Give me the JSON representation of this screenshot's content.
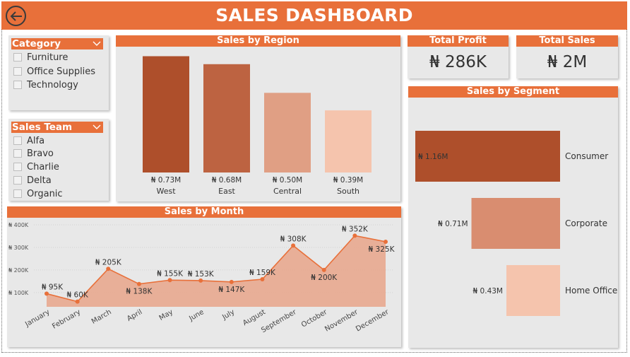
{
  "header": {
    "title": "SALES DASHBOARD"
  },
  "category_slicer": {
    "title": "Category",
    "options": [
      "Furniture",
      "Office Supplies",
      "Technology"
    ]
  },
  "sales_team_slicer": {
    "title": "Sales Team",
    "options": [
      "Alfa",
      "Bravo",
      "Charlie",
      "Delta",
      "Organic"
    ]
  },
  "kpis": {
    "total_profit": {
      "label": "Total Profit",
      "value": "₦ 286K"
    },
    "total_sales": {
      "label": "Total Sales",
      "value": "₦ 2M"
    }
  },
  "colors": {
    "accent": "#e8703a",
    "panel": "#e8e8e8"
  },
  "chart_data": [
    {
      "id": "region",
      "type": "bar",
      "title": "Sales by Region",
      "categories": [
        "West",
        "East",
        "Central",
        "South"
      ],
      "values": [
        0.73,
        0.68,
        0.5,
        0.39
      ],
      "labels": [
        "₦ 0.73M",
        "₦ 0.68M",
        "₦ 0.50M",
        "₦ 0.39M"
      ],
      "colors": [
        "#ae4f2b",
        "#bd6341",
        "#e09f84",
        "#f5c4ad"
      ],
      "ylim": [
        0,
        0.75
      ]
    },
    {
      "id": "segment",
      "type": "bar",
      "orientation": "horizontal",
      "title": "Sales by Segment",
      "categories": [
        "Consumer",
        "Corporate",
        "Home Office"
      ],
      "values": [
        1.16,
        0.71,
        0.43
      ],
      "labels": [
        "₦ 1.16M",
        "₦ 0.71M",
        "₦ 0.43M"
      ],
      "colors": [
        "#ae4f2b",
        "#d98d70",
        "#f5c4ad"
      ]
    },
    {
      "id": "month",
      "type": "area",
      "title": "Sales by Month",
      "categories": [
        "January",
        "February",
        "March",
        "April",
        "May",
        "June",
        "July",
        "August",
        "September",
        "October",
        "November",
        "December"
      ],
      "values": [
        95,
        60,
        205,
        138,
        155,
        153,
        147,
        159,
        308,
        200,
        352,
        325
      ],
      "labels": [
        "₦ 95K",
        "₦ 60K",
        "₦ 205K",
        "₦ 138K",
        "₦ 155K",
        "₦ 153K",
        "₦ 147K",
        "₦ 159K",
        "₦ 308K",
        "₦ 200K",
        "₦ 352K",
        "₦ 325K"
      ],
      "yticks": [
        100,
        200,
        300,
        400
      ],
      "ytick_labels": [
        "₦ 100K",
        "₦ 200K",
        "₦ 300K",
        "₦ 400K"
      ],
      "ylim": [
        40,
        400
      ],
      "line_color": "#e8703a",
      "fill_color": "#e8a98f"
    }
  ]
}
